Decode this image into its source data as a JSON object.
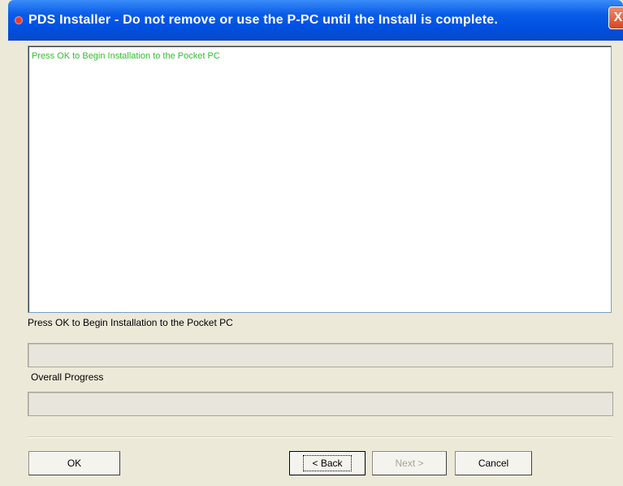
{
  "window": {
    "title": "PDS Installer - Do not remove or use the P-PC until the Install is complete.",
    "close_label": "X"
  },
  "log": {
    "lines": [
      "Press OK to Begin Installation to the Pocket PC"
    ]
  },
  "status": {
    "message": "Press OK to Begin Installation to the Pocket PC"
  },
  "progress": {
    "item_fraction": 0,
    "overall_label": "Overall Progress",
    "overall_fraction": 0
  },
  "buttons": {
    "ok": "OK",
    "back": "< Back",
    "next": "Next >",
    "cancel": "Cancel"
  }
}
